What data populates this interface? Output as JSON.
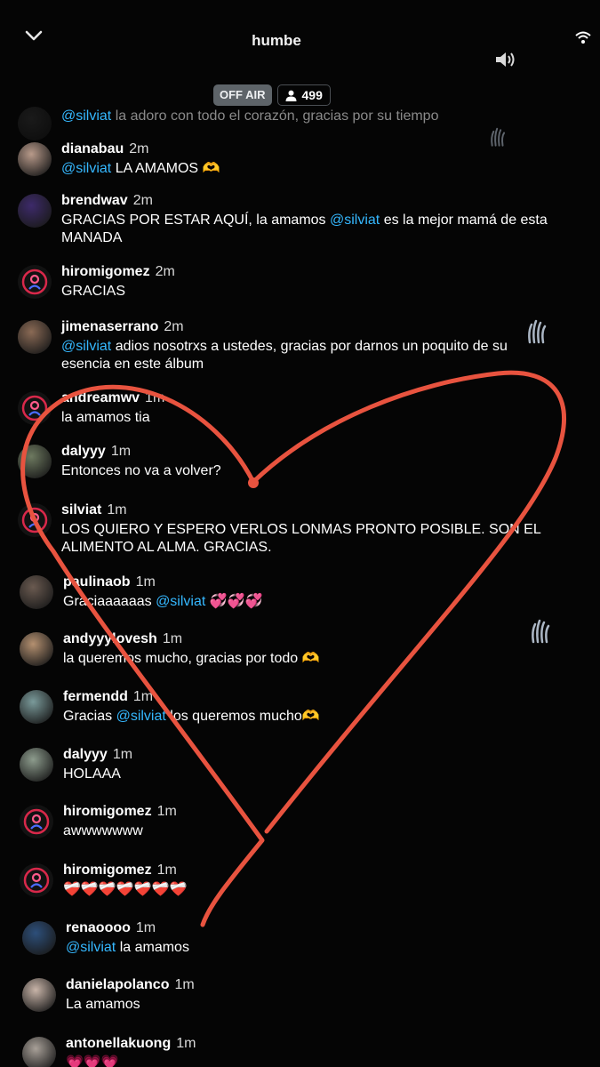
{
  "header": {
    "title": "humbe",
    "status": "OFF AIR",
    "viewer_count": "499"
  },
  "comments": [
    {
      "user": "",
      "time": "",
      "parts": [
        {
          "t": "@silviat",
          "m": true
        },
        {
          "t": " la adoro con todo el corazón, gracias por su tiempo"
        }
      ]
    },
    {
      "user": "dianabau",
      "time": "2m",
      "parts": [
        {
          "t": "@silviat",
          "m": true
        },
        {
          "t": " LA AMAMOS 🫶"
        }
      ]
    },
    {
      "user": "brendwav",
      "time": "2m",
      "parts": [
        {
          "t": "GRACIAS POR ESTAR AQUÍ, la amamos "
        },
        {
          "t": "@silviat",
          "m": true
        },
        {
          "t": "  es la mejor mamá de esta MANADA"
        }
      ]
    },
    {
      "user": "hiromigomez",
      "time": "2m",
      "parts": [
        {
          "t": "GRACIAS"
        }
      ]
    },
    {
      "user": "jimenaserrano",
      "time": "2m",
      "parts": [
        {
          "t": "@silviat",
          "m": true
        },
        {
          "t": " adios nosotrxs a ustedes, gracias por darnos un poquito de su esencia en este álbum"
        }
      ]
    },
    {
      "user": "andreamwv",
      "time": "1m",
      "parts": [
        {
          "t": "la amamos tia"
        }
      ]
    },
    {
      "user": "dalyyy",
      "time": "1m",
      "parts": [
        {
          "t": "Entonces no va a volver?"
        }
      ]
    },
    {
      "user": "silviat",
      "time": "1m",
      "parts": [
        {
          "t": "LOS QUIERO Y ESPERO VERLOS LONMAS PRONTO POSIBLE.  SON EL ALIMENTO AL ALMA.  GRACIAS."
        }
      ]
    },
    {
      "user": "paulinaob",
      "time": "1m",
      "parts": [
        {
          "t": "Graciaaaaaas "
        },
        {
          "t": "@silviat",
          "m": true
        },
        {
          "t": " 💞💞💞"
        }
      ]
    },
    {
      "user": "andyyylovesh",
      "time": "1m",
      "parts": [
        {
          "t": "la queremos mucho, gracias por todo 🫶"
        }
      ]
    },
    {
      "user": "fermendd",
      "time": "1m",
      "parts": [
        {
          "t": "Gracias "
        },
        {
          "t": "@silviat",
          "m": true
        },
        {
          "t": " los queremos mucho🫶"
        }
      ]
    },
    {
      "user": "dalyyy",
      "time": "1m",
      "parts": [
        {
          "t": "HOLAAA"
        }
      ]
    },
    {
      "user": "hiromigomez",
      "time": "1m",
      "parts": [
        {
          "t": "awwwwwww"
        }
      ]
    },
    {
      "user": "hiromigomez",
      "time": "1m",
      "parts": [
        {
          "t": "❤️‍🩹❤️‍🩹❤️‍🩹❤️‍🩹❤️‍🩹❤️‍🩹❤️‍🩹"
        }
      ]
    },
    {
      "user": "renaoooo",
      "time": "1m",
      "parts": [
        {
          "t": "@silviat",
          "m": true
        },
        {
          "t": " la amamos"
        }
      ]
    },
    {
      "user": "danielapolanco",
      "time": "1m",
      "parts": [
        {
          "t": "La amamos"
        }
      ]
    },
    {
      "user": "antonellakuong",
      "time": "1m",
      "parts": [
        {
          "t": "💗💗💗"
        }
      ]
    }
  ],
  "colors": {
    "mention": "#35b8ff",
    "heart_stroke": "#e8533f",
    "off_air_bg": "#5e6469"
  },
  "icons": {
    "back": "chevron-down-icon",
    "connectivity": "wifi-icon",
    "audio": "speaker-icon",
    "viewers": "person-icon",
    "default_avatar": "default-avatar-icon",
    "reaction": "waving-hand-icon",
    "drawing": "heart-drawing"
  }
}
